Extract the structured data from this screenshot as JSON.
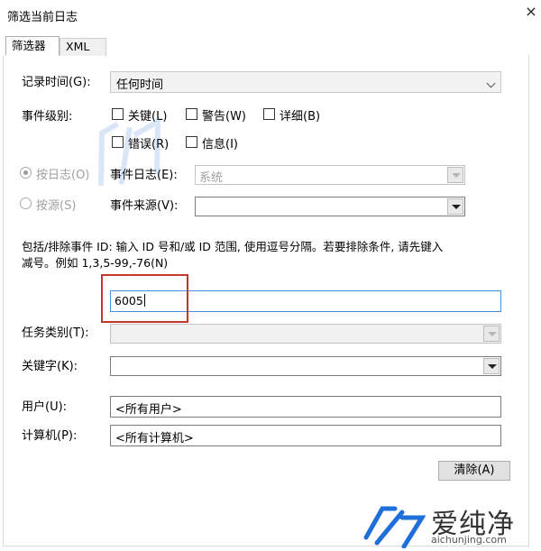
{
  "window": {
    "title": "筛选当前日志",
    "close_glyph": "×"
  },
  "tabs": [
    {
      "label": "筛选器"
    },
    {
      "label": "XML"
    }
  ],
  "logged": {
    "label": "记录时间(G):",
    "value": "任何时间"
  },
  "event_level": {
    "label": "事件级别:",
    "options": [
      {
        "label": "关键(L)",
        "checked": false
      },
      {
        "label": "警告(W)",
        "checked": false
      },
      {
        "label": "详细(B)",
        "checked": false
      },
      {
        "label": "错误(R)",
        "checked": false
      },
      {
        "label": "信息(I)",
        "checked": false
      }
    ]
  },
  "by_log": {
    "radio_label": "按日志(O)",
    "field_label": "事件日志(E):",
    "value": "系统",
    "checked": true
  },
  "by_source": {
    "radio_label": "按源(S)",
    "field_label": "事件来源(V):",
    "value": "",
    "checked": false
  },
  "event_id": {
    "description_line1": "包括/排除事件 ID: 输入 ID 号和/或 ID 范围, 使用逗号分隔。若要排除条件, 请先键入",
    "description_line2": "减号。例如 1,3,5-99,-76(N)",
    "value": "6005"
  },
  "task_category": {
    "label": "任务类别(T):",
    "value": ""
  },
  "keywords": {
    "label": "关键字(K):",
    "value": ""
  },
  "user": {
    "label": "用户(U):",
    "value": "<所有用户>"
  },
  "computer": {
    "label": "计算机(P):",
    "value": "<所有计算机>"
  },
  "clear_button": {
    "label": "清除(A)"
  },
  "watermark": {
    "brand": "爱纯净",
    "url": "aichunjing.com"
  },
  "colors": {
    "highlight_box": "#c0392b"
  }
}
